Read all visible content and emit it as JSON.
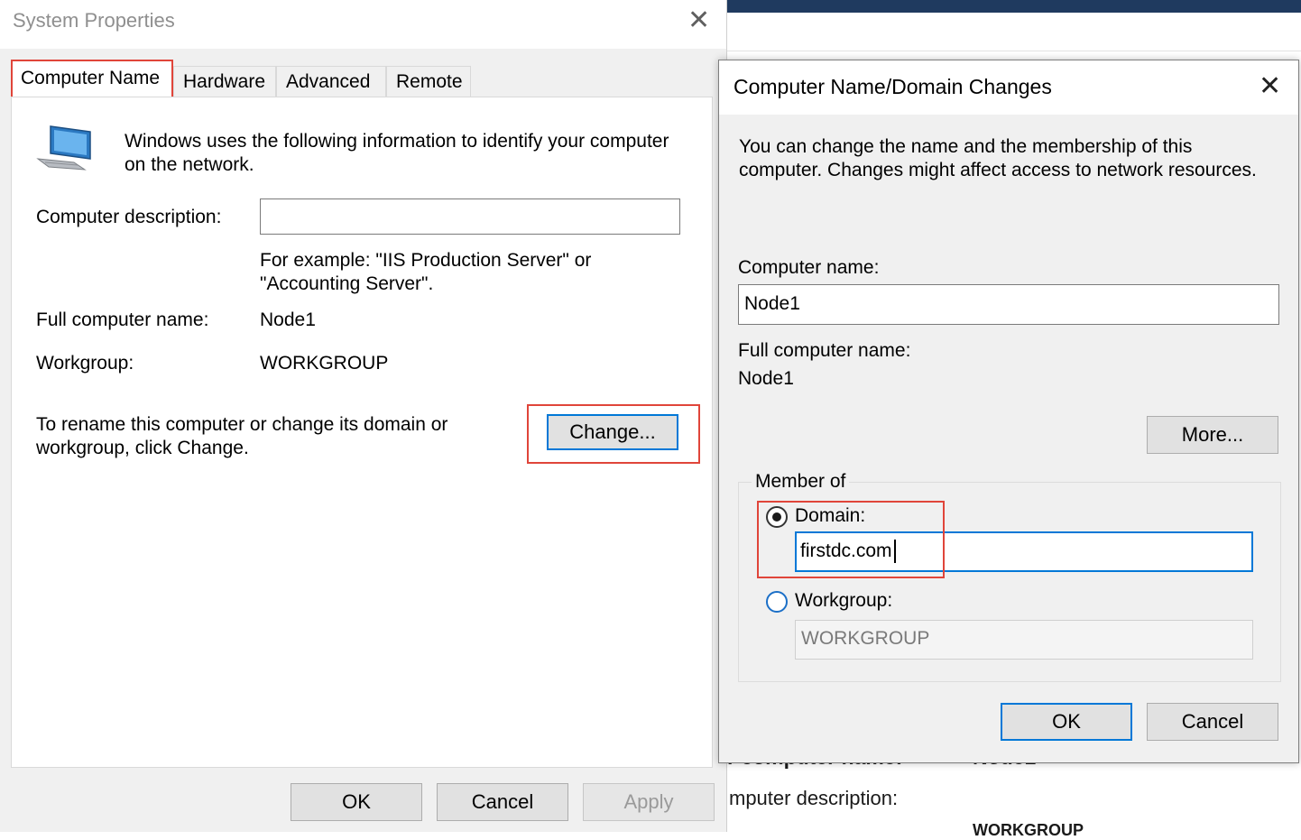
{
  "background_window": {
    "row1_label": "r computer name:",
    "row1_value": "Node1",
    "row2_label": "mputer description:",
    "row3_value": "WORKGROUP"
  },
  "system_properties": {
    "title": "System Properties",
    "tabs": [
      {
        "label": "Computer Name",
        "active": true
      },
      {
        "label": "Hardware"
      },
      {
        "label": "Advanced"
      },
      {
        "label": "Remote"
      }
    ],
    "intro_text_line1": "Windows uses the following information to identify your computer",
    "intro_text_line2": "on the network.",
    "computer_description_label": "Computer description:",
    "computer_description_value": "",
    "example_line1": "For example: \"IIS Production Server\" or",
    "example_line2": "\"Accounting Server\".",
    "full_computer_name_label": "Full computer name:",
    "full_computer_name_value": "Node1",
    "workgroup_label": "Workgroup:",
    "workgroup_value": "WORKGROUP",
    "rename_text_line1": "To rename this computer or change its domain or",
    "rename_text_line2": "workgroup, click Change.",
    "change_button": "Change...",
    "ok_button": "OK",
    "cancel_button": "Cancel",
    "apply_button": "Apply",
    "icon": "computer-icon"
  },
  "domain_changes": {
    "title": "Computer Name/Domain Changes",
    "intro_line1": "You can change the name and the membership of this",
    "intro_line2": "computer. Changes might affect access to network resources.",
    "computer_name_label": "Computer name:",
    "computer_name_value": "Node1",
    "full_computer_name_label": "Full computer name:",
    "full_computer_name_value": "Node1",
    "more_button": "More...",
    "member_of_label": "Member of",
    "domain_label": "Domain:",
    "domain_value": "firstdc.com",
    "domain_selected": true,
    "workgroup_label": "Workgroup:",
    "workgroup_value": "WORKGROUP",
    "ok_button": "OK",
    "cancel_button": "Cancel"
  },
  "colors": {
    "highlight_box": "#e0453a",
    "focus_blue": "#0078d7",
    "dialog_bg": "#f0f0f0"
  }
}
